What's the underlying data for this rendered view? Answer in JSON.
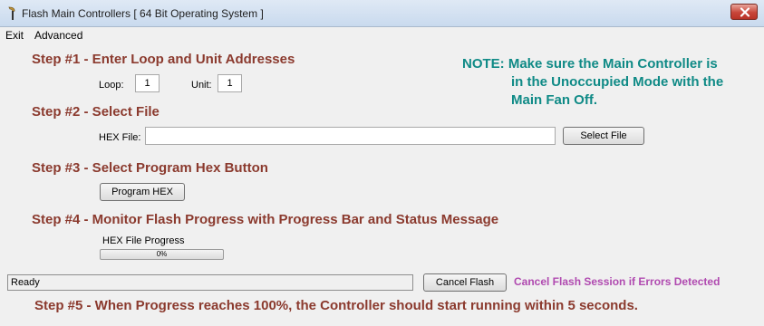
{
  "window": {
    "title": "Flash Main Controllers [ 64 Bit Operating System ]",
    "icons": {
      "app": "wrench-icon",
      "close": "close-icon"
    }
  },
  "menu": {
    "items": [
      "Exit",
      "Advanced"
    ]
  },
  "steps": {
    "step1": "Step #1 - Enter Loop and Unit Addresses",
    "step2": "Step #2 - Select File",
    "step3": "Step #3 - Select Program Hex Button",
    "step4": "Step #4 - Monitor Flash Progress with Progress Bar and Status Message",
    "step5": "Step #5 - When Progress reaches 100%, the Controller should start running within 5 seconds."
  },
  "note": {
    "line1": "NOTE: Make sure the Main Controller is",
    "line2": "in the Unoccupied Mode with the",
    "line3": "Main Fan Off."
  },
  "address": {
    "loop_label": "Loop:",
    "loop_value": "1",
    "unit_label": "Unit:",
    "unit_value": "1"
  },
  "file": {
    "hex_label": "HEX File:",
    "hex_value": "",
    "select_button": "Select File"
  },
  "program": {
    "button": "Program HEX"
  },
  "progress": {
    "label": "HEX File Progress",
    "value": 0,
    "text": "0%"
  },
  "status": {
    "message": "Ready",
    "cancel_button": "Cancel Flash",
    "cancel_message": "Cancel Flash Session if Errors Detected"
  },
  "colors": {
    "step": "#8b3a2e",
    "note": "#0f8a86",
    "cancel_message": "#b04ab0",
    "progress_fill": "#06b025"
  }
}
